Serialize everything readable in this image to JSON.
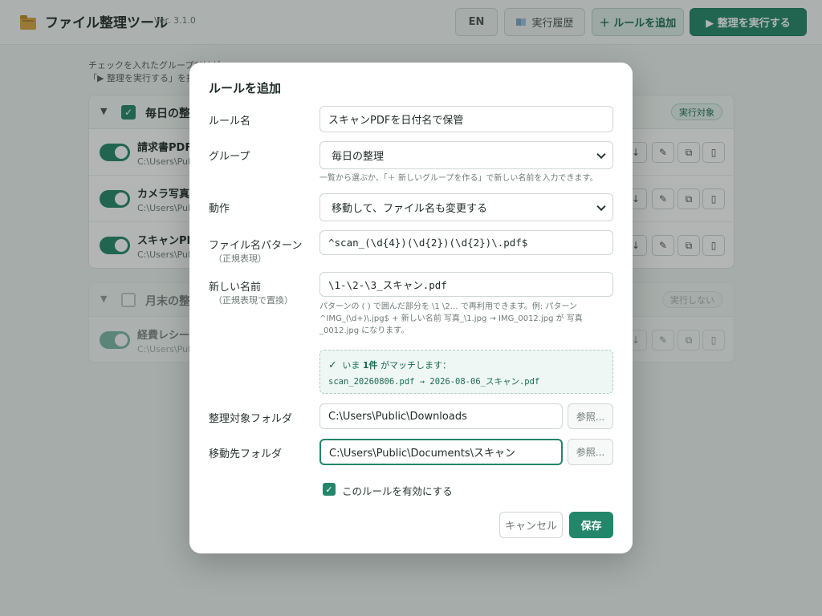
{
  "header": {
    "app_icon": "folder-icon",
    "title": "ファイル整理ツール",
    "version": "Ver. 3.1.0",
    "lang_button": "EN",
    "history_button": "実行履歴",
    "history_icon": "book-icon",
    "add_rule_button": "＋ ルールを追加",
    "run_button": "▶ 整理を実行する"
  },
  "main": {
    "intro_line1": "チェックを入れたグループだけが",
    "intro_line2": "「▶ 整理を実行する」を押",
    "groups": [
      {
        "name": "毎日の整",
        "checked": true,
        "badge": "実行対象",
        "rules": [
          {
            "name": "請求書PDF",
            "path": "C:\\Users\\Pub",
            "enabled": true
          },
          {
            "name": "カメラ写真の",
            "path": "C:\\Users\\Pub",
            "enabled": true
          },
          {
            "name": "スキャンPDF",
            "path": "C:\\Users\\Pub",
            "enabled": true
          }
        ]
      },
      {
        "name": "月末の整",
        "checked": false,
        "badge": "実行しない",
        "rules": [
          {
            "name": "経費レシート",
            "path": "C:\\Users\\Pub",
            "enabled": true
          }
        ]
      }
    ],
    "row_action_icons": [
      "arrow-down-icon",
      "edit-icon",
      "duplicate-icon",
      "trash-icon"
    ]
  },
  "modal": {
    "title": "ルールを追加",
    "rule_name_label": "ルール名",
    "rule_name_value": "スキャンPDFを日付名で保管",
    "group_label": "グループ",
    "group_value": "毎日の整理",
    "group_help": "一覧から選ぶか、「＋ 新しいグループを作る」で新しい名前を入力できます。",
    "action_label": "動作",
    "action_value": "移動して、ファイル名も変更する",
    "pattern_label": "ファイル名パターン",
    "pattern_sub": "（正規表現）",
    "pattern_value": "^scan_(\\d{4})(\\d{2})(\\d{2})\\.pdf$",
    "newname_label": "新しい名前",
    "newname_sub": "（正規表現で置換）",
    "newname_value": "\\1-\\2-\\3_スキャン.pdf",
    "newname_help_line1": "パターンの ( ) で囲んだ部分を \\1 \\2… で再利用できます。例: パターン",
    "newname_help_line2": "^IMG_(\\d+)\\.jpg$ + 新しい名前 写真_\\1.jpg → IMG_0012.jpg が 写真",
    "newname_help_line3": "_0012.jpg になります。",
    "match_prefix": "いま",
    "match_count": "1件",
    "match_suffix": "がマッチします：",
    "match_example": "scan_20260806.pdf → 2026-08-06_スキャン.pdf",
    "source_label": "整理対象フォルダ",
    "source_value": "C:\\Users\\Public\\Downloads",
    "dest_label": "移動先フォルダ",
    "dest_value": "C:\\Users\\Public\\Documents\\スキャン",
    "browse_label": "参照...",
    "enable_label": "このルールを有効にする",
    "enable_checked": true,
    "cancel_label": "キャンセル",
    "save_label": "保存"
  },
  "colors": {
    "accent": "#23866a",
    "accent_light": "#dcece6",
    "background": "#edf1f0"
  }
}
